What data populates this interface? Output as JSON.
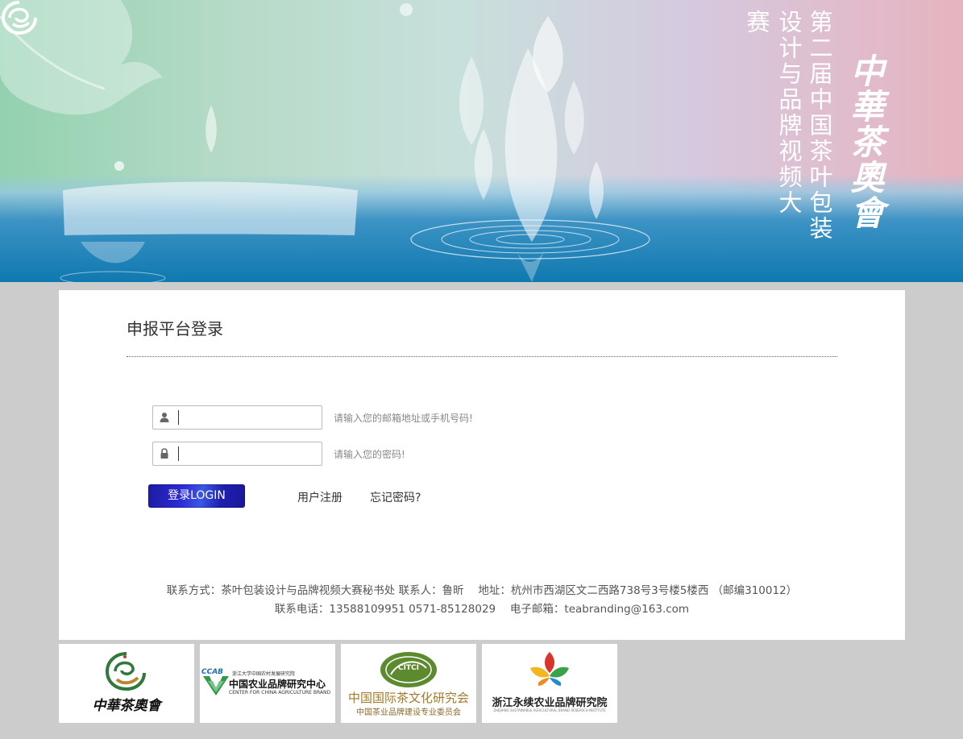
{
  "banner": {
    "title_col1": "第二届中国茶叶包装",
    "title_col2": "设计与品牌视频大赛",
    "brand_text": "中華茶奧會"
  },
  "login": {
    "title": "申报平台登录",
    "username": {
      "value": "",
      "placeholder": "",
      "hint": "请输入您的邮箱地址或手机号码!"
    },
    "password": {
      "value": "",
      "placeholder": "",
      "hint": "请输入您的密码!"
    },
    "login_button": "登录LOGIN",
    "register_link": "用户注册",
    "forgot_link": "忘记密码?"
  },
  "footer": {
    "line1": "联系方式：茶叶包装设计与品牌视频大赛秘书处 联系人：鲁昕　 地址：杭州市西湖区文二西路738号3号楼5楼西 （邮编310012）",
    "line2": "联系电话：13588109951 0571-85128029　 电子邮箱：teabranding@163.com"
  },
  "partners": [
    {
      "name": "中華茶奧會"
    },
    {
      "name": "中国农业品牌研究中心",
      "abbr": "CCAB",
      "sub_cn": "浙江大学中国农村发展研究院",
      "sub_en": "CENTER FOR CHINA AGRICULTURE BRAND"
    },
    {
      "name": "中国国际茶文化研究会",
      "abbr": "CITCI",
      "sub_cn": "中国茶业品牌建设专业委员会"
    },
    {
      "name": "浙江永续农业品牌研究院",
      "sub_en": "ZHEJIANG SUSTAINABLE AGRICULTURAL BRAND RESEARCH INSTITUTE"
    }
  ],
  "colors": {
    "page_bg": "#cccccc",
    "button_blue": "#2c2bd6",
    "brand_green": "#2f7a3a",
    "brand_gold": "#b8862f"
  },
  "icons": [
    "user-icon",
    "lock-icon"
  ]
}
